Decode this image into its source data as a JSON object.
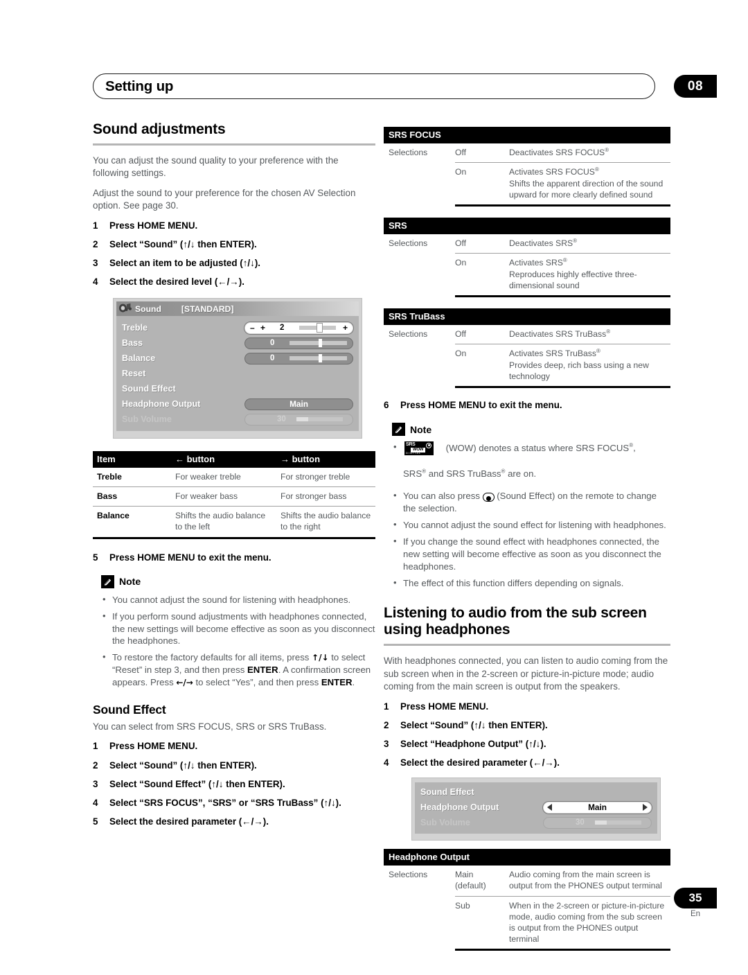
{
  "page": {
    "header_title": "Setting up",
    "chapter_tag": "08",
    "page_number": "35",
    "language_code": "En"
  },
  "left_column": {
    "section_title": "Sound adjustments",
    "intro_paragraph_1": "You can adjust the sound quality to your preference with the following settings.",
    "intro_paragraph_2": "Adjust the sound to your preference for the chosen AV Selection option. See page 30.",
    "steps": [
      {
        "num": "1",
        "text": "Press HOME MENU."
      },
      {
        "num": "2",
        "text": "Select “Sound” (↑/↓ then ENTER)."
      },
      {
        "num": "3",
        "text": "Select an item to be adjusted (↑/↓)."
      },
      {
        "num": "4",
        "text": "Select the desired level (←/→)."
      }
    ],
    "osd_screenshot": {
      "icon": "speaker-music-icon",
      "title": "Sound",
      "mode": "[STANDARD]",
      "rows": [
        {
          "label": "Treble",
          "value": "2",
          "type": "slider-selected"
        },
        {
          "label": "Bass",
          "value": "0",
          "type": "slider"
        },
        {
          "label": "Balance",
          "value": "0",
          "type": "slider"
        },
        {
          "label": "Reset",
          "value": "",
          "type": "none"
        },
        {
          "label": "Sound Effect",
          "value": "",
          "type": "none"
        },
        {
          "label": "Headphone Output",
          "value": "Main",
          "type": "option"
        },
        {
          "label": "Sub Volume",
          "value": "30",
          "type": "slider-dim"
        }
      ]
    },
    "item_table": {
      "headers": [
        "Item",
        "← button",
        "→ button"
      ],
      "rows": [
        {
          "item": "Treble",
          "left": "For weaker treble",
          "right": "For stronger treble"
        },
        {
          "item": "Bass",
          "left": "For weaker bass",
          "right": "For stronger bass"
        },
        {
          "item": "Balance",
          "left": "Shifts the audio balance to the left",
          "right": "Shifts the audio balance to the right"
        }
      ]
    },
    "step5": {
      "num": "5",
      "text": "Press HOME MENU to exit the menu."
    },
    "note": {
      "title": "Note",
      "bullets": [
        "You cannot adjust the sound for listening with headphones.",
        "If you perform sound adjustments with headphones connected, the new settings will become effective as soon as you disconnect the headphones."
      ],
      "bullet3_part1": "To restore the factory defaults for all items, press ",
      "bullet3_arrows1": "↑/↓",
      "bullet3_part2": " to select “Reset” in step 3, and then press ",
      "bullet3_bold1": "ENTER",
      "bullet3_part3": ". A confirmation screen appears. Press ",
      "bullet3_arrows2": "←/→",
      "bullet3_part4": " to select “Yes”, and then press ",
      "bullet3_bold2": "ENTER",
      "bullet3_part5": "."
    },
    "sound_effect": {
      "title": "Sound Effect",
      "intro": "You can select from SRS FOCUS, SRS or SRS TruBass.",
      "steps": [
        {
          "num": "1",
          "text": "Press HOME MENU."
        },
        {
          "num": "2",
          "text": "Select “Sound” (↑/↓ then ENTER)."
        },
        {
          "num": "3",
          "text": "Select “Sound Effect” (↑/↓ then ENTER)."
        },
        {
          "num": "4",
          "text": "Select “SRS FOCUS”, “SRS” or “SRS TruBass” (↑/↓)."
        },
        {
          "num": "5",
          "text": "Select the desired parameter (←/→)."
        }
      ]
    }
  },
  "right_column": {
    "spec_tables": [
      {
        "title": "SRS FOCUS",
        "selections_label": "Selections",
        "rows": [
          {
            "option": "Off",
            "desc_main": "Deactivates SRS FOCUS",
            "reg": true,
            "desc_extra": ""
          },
          {
            "option": "On",
            "desc_main": "Activates SRS FOCUS",
            "reg": true,
            "desc_extra": "Shifts the apparent direction of the sound upward for more clearly defined sound"
          }
        ]
      },
      {
        "title": "SRS",
        "selections_label": "Selections",
        "rows": [
          {
            "option": "Off",
            "desc_main": "Deactivates SRS",
            "reg": true,
            "desc_extra": ""
          },
          {
            "option": "On",
            "desc_main": "Activates SRS",
            "reg": true,
            "desc_extra": "Reproduces highly effective three-dimensional sound"
          }
        ]
      },
      {
        "title": "SRS TruBass",
        "selections_label": "Selections",
        "rows": [
          {
            "option": "Off",
            "desc_main": "Deactivates SRS TruBass",
            "reg": true,
            "desc_extra": ""
          },
          {
            "option": "On",
            "desc_main": "Activates SRS TruBass",
            "reg": true,
            "desc_extra": "Provides deep, rich bass using a new technology"
          }
        ]
      }
    ],
    "step6": {
      "num": "6",
      "text": "Press HOME MENU to exit the menu."
    },
    "note": {
      "title": "Note",
      "logo_name": "srs-wow-digital-logo",
      "bullet1_a": "(WOW) denotes a status where SRS FOCUS",
      "bullet1_b": ", ",
      "bullet1_c": "SRS",
      "bullet1_d": " and SRS TruBass",
      "bullet1_e": " are on.",
      "bullet2_a": "You can also press ",
      "bullet2_b": " (Sound Effect) on the remote to change the selection.",
      "bullets_rest": [
        "You cannot adjust the sound effect for listening with headphones.",
        "If you change the sound effect with headphones connected, the new setting will become effective as soon as you disconnect the headphones.",
        "The effect of this function differs depending on signals."
      ]
    },
    "sub_screen": {
      "title_line1": "Listening to audio from the sub screen",
      "title_line2": "using headphones",
      "intro": "With headphones connected, you can listen to audio coming from the sub screen when in the 2-screen or picture-in-picture mode; audio coming from the main screen is output from the speakers.",
      "steps": [
        {
          "num": "1",
          "text": "Press HOME MENU."
        },
        {
          "num": "2",
          "text": "Select “Sound” (↑/↓ then ENTER)."
        },
        {
          "num": "3",
          "text": "Select “Headphone Output” (↑/↓)."
        },
        {
          "num": "4",
          "text": "Select the desired parameter (←/→)."
        }
      ],
      "osd_screenshot": {
        "rows": [
          {
            "label": "Sound Effect",
            "value": "",
            "type": "none"
          },
          {
            "label": "Headphone Output",
            "value": "Main",
            "type": "option-selected"
          },
          {
            "label": "Sub Volume",
            "value": "30",
            "type": "slider-dim"
          }
        ]
      },
      "spec_table": {
        "title": "Headphone Output",
        "selections_label": "Selections",
        "rows": [
          {
            "option": "Main",
            "option_sub": "(default)",
            "desc": "Audio coming from the main screen is output from the PHONES output terminal"
          },
          {
            "option": "Sub",
            "option_sub": "",
            "desc": "When in the 2-screen or picture-in-picture mode, audio coming from the sub screen is output from the PHONES output terminal"
          }
        ]
      }
    }
  }
}
